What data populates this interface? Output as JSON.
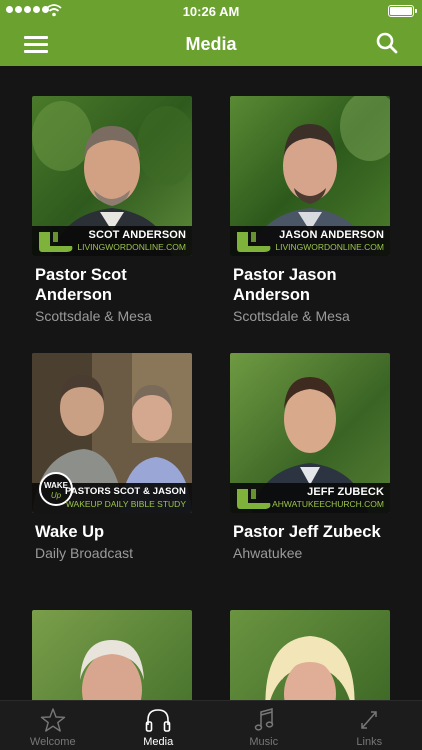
{
  "status_bar": {
    "time": "10:26 AM"
  },
  "header": {
    "title": "Media"
  },
  "cards": [
    {
      "name": "Pastor Scot Anderson",
      "subtitle": "Scottsdale & Mesa",
      "banner_name": "SCOT ANDERSON",
      "banner_url": "LIVINGWORDONLINE.COM"
    },
    {
      "name": "Pastor Jason Anderson",
      "subtitle": "Scottsdale & Mesa",
      "banner_name": "JASON ANDERSON",
      "banner_url": "LIVINGWORDONLINE.COM"
    },
    {
      "name": "Wake Up",
      "subtitle": "Daily Broadcast",
      "banner_name": "PASTORS SCOT & JASON",
      "banner_url": "WAKEUP DAILY BIBLE STUDY",
      "badge": "WAKE Up"
    },
    {
      "name": "Pastor Jeff Zubeck",
      "subtitle": "Ahwatukee",
      "banner_name": "JEFF ZUBECK",
      "banner_url": "AHWATUKEECHURCH.COM"
    },
    {
      "name": "",
      "subtitle": ""
    },
    {
      "name": "",
      "subtitle": ""
    }
  ],
  "tabs": [
    {
      "label": "Welcome",
      "icon": "star-icon"
    },
    {
      "label": "Media",
      "icon": "headphones-icon"
    },
    {
      "label": "Music",
      "icon": "music-note-icon"
    },
    {
      "label": "Links",
      "icon": "links-icon"
    }
  ],
  "colors": {
    "accent": "#6aa12f",
    "background": "#151515",
    "tab_bar": "#1c1c1c",
    "subtitle": "#9a9a9a"
  }
}
